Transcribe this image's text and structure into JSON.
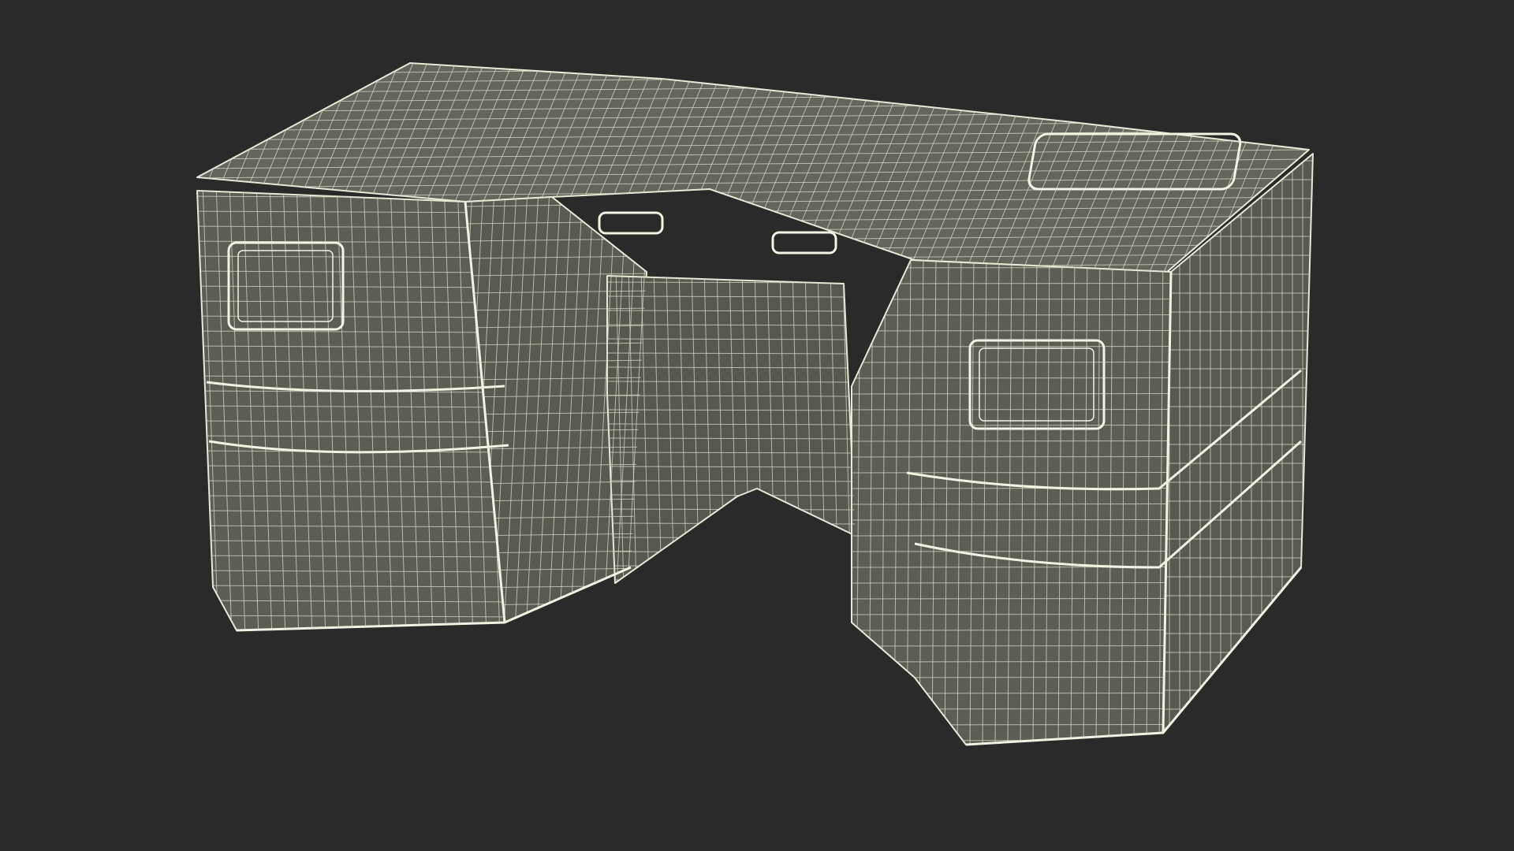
{
  "scene": {
    "subject": "desk-wireframe-render",
    "colors": {
      "background": "#2a2a2a",
      "surface": "#5b5c54",
      "surface_dark": "#4a4b44",
      "surface_light": "#666760",
      "wire": "#d8d8c8",
      "wire_strong": "#efefe0"
    }
  }
}
